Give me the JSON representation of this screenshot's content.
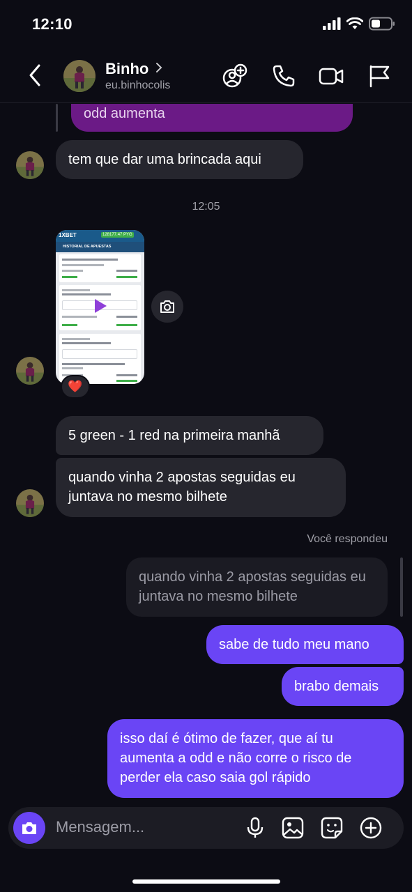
{
  "status_bar": {
    "time": "12:10"
  },
  "header": {
    "contact_name": "Binho",
    "contact_handle": "eu.binhocolis"
  },
  "messages": {
    "quoted_top": "odd aumenta",
    "msg1": "tem que dar uma brincada aqui",
    "timestamp": "12:05",
    "screenshot": {
      "brand": "1XBET",
      "balance": "128177.47 PYG",
      "title": "HISTORIAL DE APUESTAS",
      "reaction": "❤️"
    },
    "msg2": "5 green - 1 red na primeira manhã",
    "msg3_line1": "quando vinha 2 apostas seguidas eu",
    "msg3_line2": "juntava no mesmo bilhete",
    "reply_label": "Você respondeu",
    "reply_quote_line1": "quando vinha 2 apostas seguidas eu",
    "reply_quote_line2": "juntava no mesmo bilhete",
    "out1": "sabe de tudo meu mano",
    "out2": "brabo demais",
    "out3_line1": "isso daí é ótimo de fazer, que aí tu",
    "out3_line2": "aumenta a odd e não corre o risco de",
    "out3_line3": "perder ela caso saia gol rápido"
  },
  "composer": {
    "placeholder": "Mensagem..."
  },
  "icons": {
    "back": "chevron-left-icon",
    "add_people": "add-people-icon",
    "phone": "phone-icon",
    "video": "video-icon",
    "flag": "flag-icon",
    "camera": "camera-icon",
    "mic": "mic-icon",
    "gallery": "gallery-icon",
    "sticker": "sticker-icon",
    "plus": "plus-icon"
  },
  "colors": {
    "accent": "#6a45f5",
    "quoted": "#6b1a86",
    "incoming": "#26262e",
    "background": "#0c0c14"
  }
}
